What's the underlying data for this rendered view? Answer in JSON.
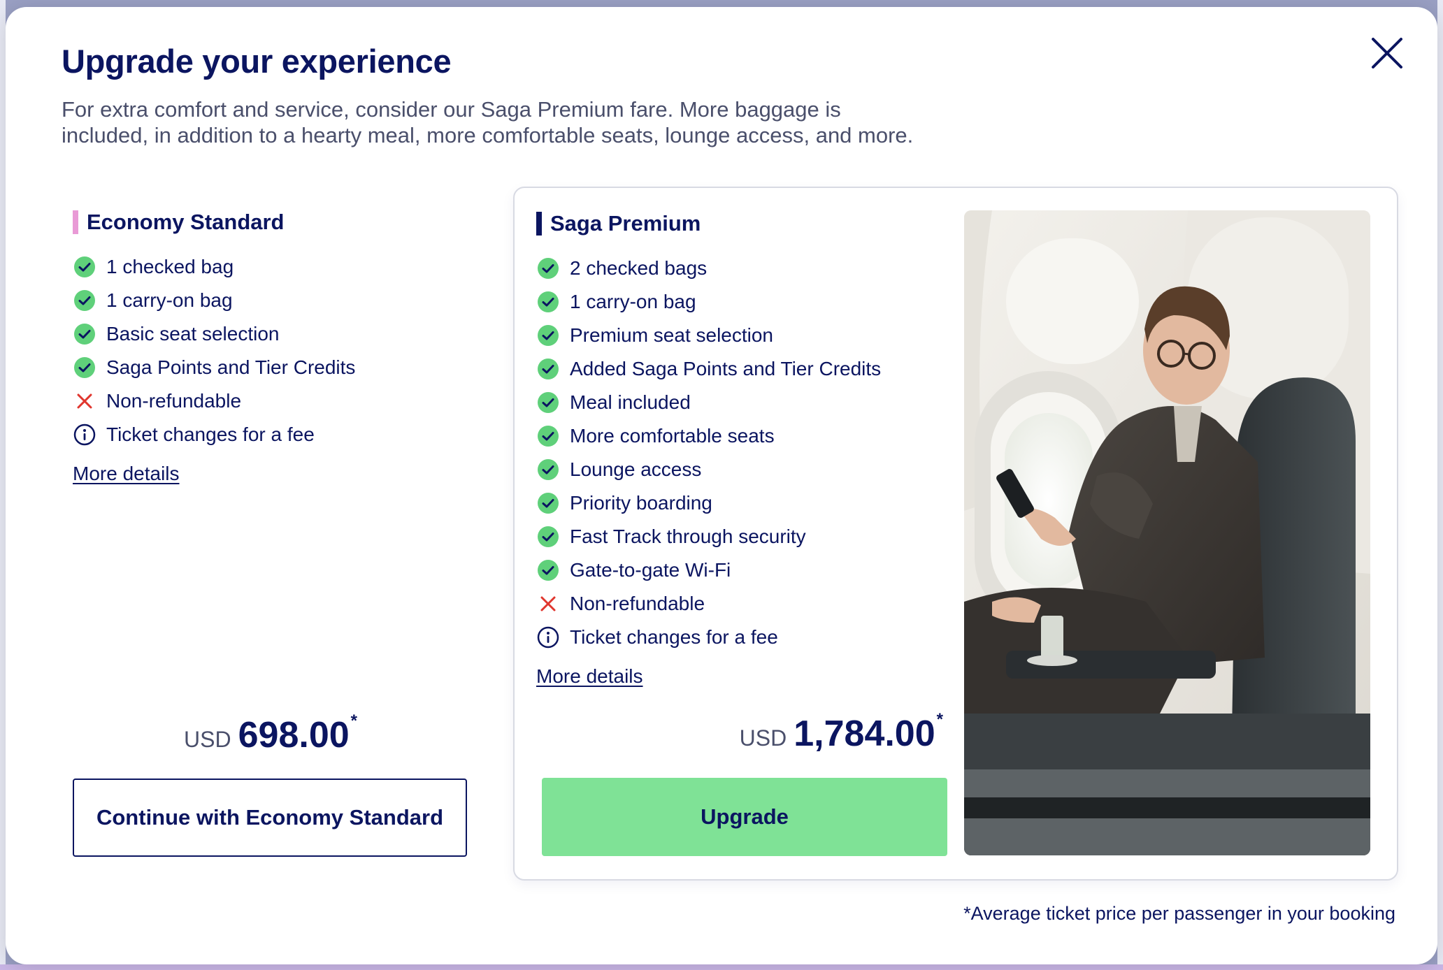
{
  "modal": {
    "title": "Upgrade your experience",
    "subtitle_line1": "For extra comfort and service, consider our Saga Premium fare. More baggage is",
    "subtitle_line2": "included, in addition to a hearty meal, more comfortable seats, lounge access, and more.",
    "close_icon": "close-icon"
  },
  "economy": {
    "title": "Economy Standard",
    "accent_color": "#e99ad6",
    "features": [
      {
        "icon": "check-icon",
        "label": "1 checked bag"
      },
      {
        "icon": "check-icon",
        "label": "1 carry-on bag"
      },
      {
        "icon": "check-icon",
        "label": "Basic seat selection"
      },
      {
        "icon": "check-icon",
        "label": "Saga Points and Tier Credits"
      },
      {
        "icon": "cross-icon",
        "label": "Non-refundable"
      },
      {
        "icon": "info-icon",
        "label": "Ticket changes for a fee"
      }
    ],
    "more_details": "More details",
    "currency": "USD",
    "price": "698.00",
    "price_marker": "*",
    "button_label": "Continue with Economy Standard"
  },
  "premium": {
    "title": "Saga Premium",
    "accent_color": "#0b1560",
    "features": [
      {
        "icon": "check-icon",
        "label": "2 checked bags"
      },
      {
        "icon": "check-icon",
        "label": "1 carry-on bag"
      },
      {
        "icon": "check-icon",
        "label": "Premium seat selection"
      },
      {
        "icon": "check-icon",
        "label": "Added Saga Points and Tier Credits"
      },
      {
        "icon": "check-icon",
        "label": "Meal included"
      },
      {
        "icon": "check-icon",
        "label": "More comfortable seats"
      },
      {
        "icon": "check-icon",
        "label": "Lounge access"
      },
      {
        "icon": "check-icon",
        "label": "Priority boarding"
      },
      {
        "icon": "check-icon",
        "label": "Fast Track through security"
      },
      {
        "icon": "check-icon",
        "label": "Gate-to-gate Wi-Fi"
      },
      {
        "icon": "cross-icon",
        "label": "Non-refundable"
      },
      {
        "icon": "info-icon",
        "label": "Ticket changes for a fee"
      }
    ],
    "more_details": "More details",
    "currency": "USD",
    "price": "1,784.00",
    "price_marker": "*",
    "button_label": "Upgrade",
    "button_color": "#7fe296",
    "image": "passenger-in-premium-seat-photo"
  },
  "footnote": "*Average ticket price per passenger in your booking",
  "colors": {
    "navy": "#0b1560",
    "check_green": "#5fd07a",
    "cross_red": "#e0362e"
  }
}
